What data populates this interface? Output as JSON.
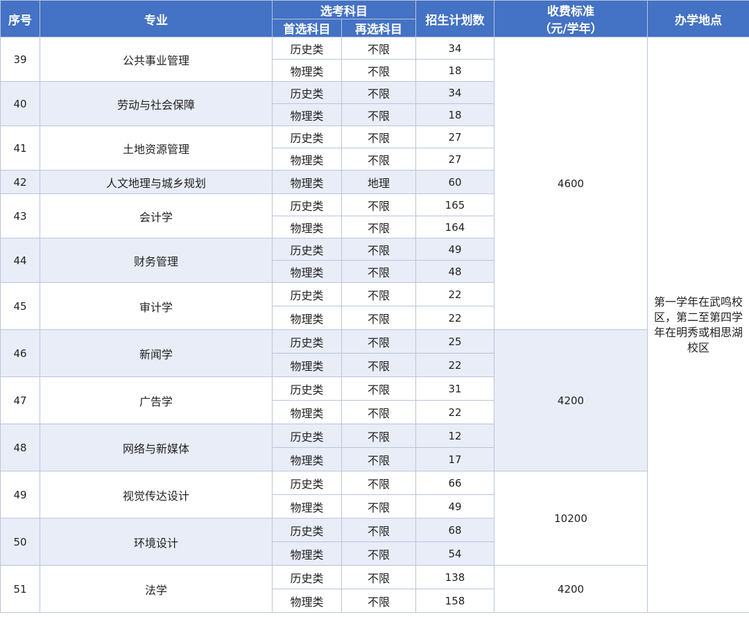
{
  "header": {
    "seq": "序号",
    "major": "专业",
    "subjects": "选考科目",
    "first_subject": "首选科目",
    "second_subject": "再选科目",
    "plan": "招生计划数",
    "fee_line1": "收费标准",
    "fee_line2": "（元/学年）",
    "location": "办学地点"
  },
  "rows": [
    {
      "seq": "39",
      "major": "公共事业管理",
      "items": [
        {
          "first": "历史类",
          "second": "不限",
          "plan": "34"
        },
        {
          "first": "物理类",
          "second": "不限",
          "plan": "18"
        }
      ]
    },
    {
      "seq": "40",
      "major": "劳动与社会保障",
      "items": [
        {
          "first": "历史类",
          "second": "不限",
          "plan": "34"
        },
        {
          "first": "物理类",
          "second": "不限",
          "plan": "18"
        }
      ]
    },
    {
      "seq": "41",
      "major": "土地资源管理",
      "items": [
        {
          "first": "历史类",
          "second": "不限",
          "plan": "27"
        },
        {
          "first": "物理类",
          "second": "不限",
          "plan": "27"
        }
      ]
    },
    {
      "seq": "42",
      "major": "人文地理与城乡规划",
      "items": [
        {
          "first": "物理类",
          "second": "地理",
          "plan": "60"
        }
      ]
    },
    {
      "seq": "43",
      "major": "会计学",
      "items": [
        {
          "first": "历史类",
          "second": "不限",
          "plan": "165"
        },
        {
          "first": "物理类",
          "second": "不限",
          "plan": "164"
        }
      ]
    },
    {
      "seq": "44",
      "major": "财务管理",
      "items": [
        {
          "first": "历史类",
          "second": "不限",
          "plan": "49"
        },
        {
          "first": "物理类",
          "second": "不限",
          "plan": "48"
        }
      ]
    },
    {
      "seq": "45",
      "major": "审计学",
      "items": [
        {
          "first": "历史类",
          "second": "不限",
          "plan": "22"
        },
        {
          "first": "物理类",
          "second": "不限",
          "plan": "22"
        }
      ]
    },
    {
      "seq": "46",
      "major": "新闻学",
      "items": [
        {
          "first": "历史类",
          "second": "不限",
          "plan": "25"
        },
        {
          "first": "物理类",
          "second": "不限",
          "plan": "22"
        }
      ]
    },
    {
      "seq": "47",
      "major": "广告学",
      "items": [
        {
          "first": "历史类",
          "second": "不限",
          "plan": "31"
        },
        {
          "first": "物理类",
          "second": "不限",
          "plan": "22"
        }
      ]
    },
    {
      "seq": "48",
      "major": "网络与新媒体",
      "items": [
        {
          "first": "历史类",
          "second": "不限",
          "plan": "12"
        },
        {
          "first": "物理类",
          "second": "不限",
          "plan": "17"
        }
      ]
    },
    {
      "seq": "49",
      "major": "视觉传达设计",
      "items": [
        {
          "first": "历史类",
          "second": "不限",
          "plan": "66"
        },
        {
          "first": "物理类",
          "second": "不限",
          "plan": "49"
        }
      ]
    },
    {
      "seq": "50",
      "major": "环境设计",
      "items": [
        {
          "first": "历史类",
          "second": "不限",
          "plan": "68"
        },
        {
          "first": "物理类",
          "second": "不限",
          "plan": "54"
        }
      ]
    },
    {
      "seq": "51",
      "major": "法学",
      "items": [
        {
          "first": "历史类",
          "second": "不限",
          "plan": "138"
        },
        {
          "first": "物理类",
          "second": "不限",
          "plan": "158"
        }
      ]
    }
  ],
  "fees": [
    {
      "value": "4600",
      "from": 0,
      "to": 6,
      "shaded": false
    },
    {
      "value": "4200",
      "from": 7,
      "to": 9,
      "shaded": true
    },
    {
      "value": "10200",
      "from": 10,
      "to": 11,
      "shaded": false
    },
    {
      "value": "4200",
      "from": 12,
      "to": 12,
      "shaded": false
    }
  ],
  "location_text": "第一学年在武鸣校区，第二至第四学年在明秀或相思湖校区",
  "colors": {
    "header_bg": "#4472c4",
    "band": "#e9edf8",
    "border": "#b9c4da"
  }
}
